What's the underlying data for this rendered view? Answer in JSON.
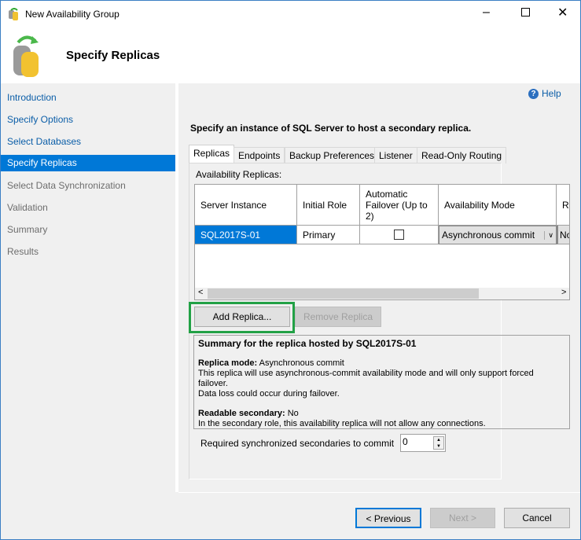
{
  "window": {
    "title": "New Availability Group",
    "page_title": "Specify Replicas"
  },
  "nav": [
    "Introduction",
    "Specify Options",
    "Select Databases",
    "Specify Replicas",
    "Select Data Synchronization",
    "Validation",
    "Summary",
    "Results"
  ],
  "help": "Help",
  "instruction": "Specify an instance of SQL Server to host a secondary replica.",
  "tabs": [
    "Replicas",
    "Endpoints",
    "Backup Preferences",
    "Listener",
    "Read-Only Routing"
  ],
  "grid": {
    "label": "Availability Replicas:",
    "headers": [
      "Server Instance",
      "Initial Role",
      "Automatic Failover (Up to 2)",
      "Availability Mode",
      "R"
    ],
    "row": {
      "server": "SQL2017S-01",
      "role": "Primary",
      "failover": false,
      "mode": "Asynchronous commit",
      "readable": "No"
    }
  },
  "buttons": {
    "add": "Add Replica...",
    "remove": "Remove Replica",
    "previous": "< Previous",
    "next": "Next >",
    "cancel": "Cancel"
  },
  "summary": {
    "title": "Summary for the replica hosted by SQL2017S-01",
    "mode_label": "Replica mode:",
    "mode_value": " Asynchronous commit",
    "mode_desc1": "This replica will use asynchronous-commit availability mode and will only support forced failover.",
    "mode_desc2": "Data loss could occur during failover.",
    "readable_label": "Readable secondary:",
    "readable_value": " No",
    "readable_desc": "In the secondary role, this availability replica will not allow any connections."
  },
  "required": {
    "label": "Required synchronized secondaries to commit",
    "value": "0"
  }
}
